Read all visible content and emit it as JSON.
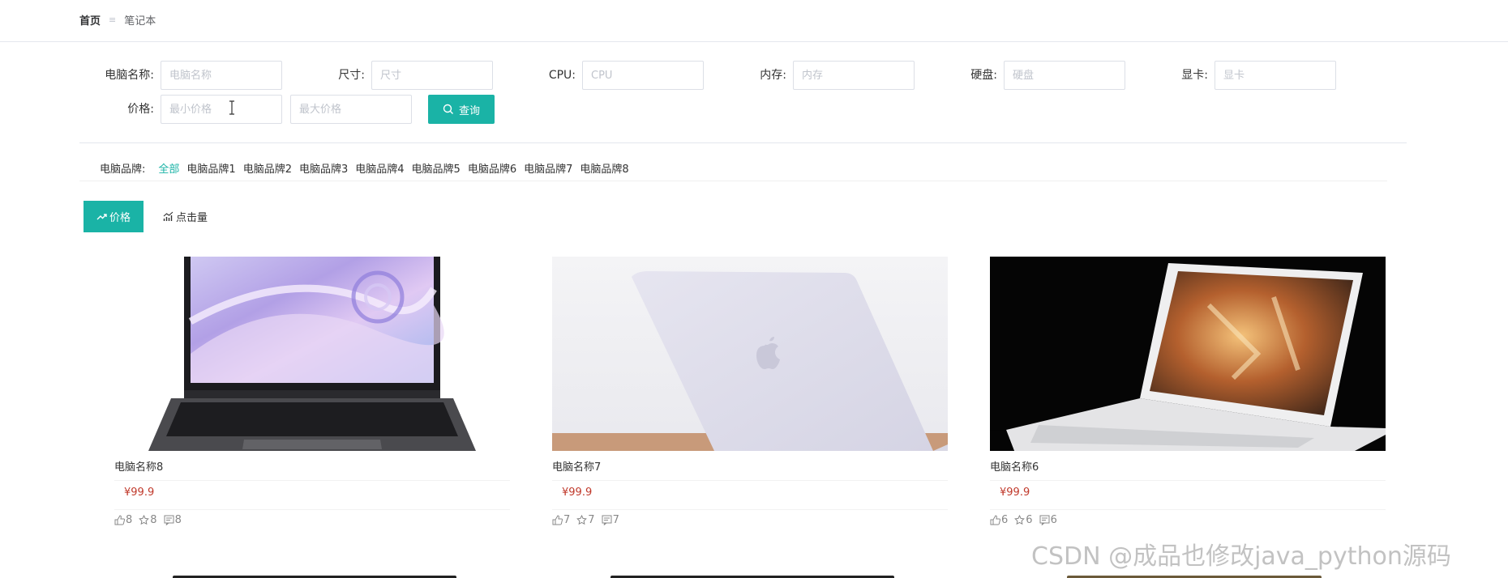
{
  "breadcrumb": {
    "home": "首页",
    "separator": "≡",
    "current": "笔记本"
  },
  "filters": {
    "name": {
      "label": "电脑名称:",
      "placeholder": "电脑名称"
    },
    "size": {
      "label": "尺寸:",
      "placeholder": "尺寸"
    },
    "cpu": {
      "label": "CPU:",
      "placeholder": "CPU"
    },
    "memory": {
      "label": "内存:",
      "placeholder": "内存"
    },
    "disk": {
      "label": "硬盘:",
      "placeholder": "硬盘"
    },
    "gpu": {
      "label": "显卡:",
      "placeholder": "显卡"
    },
    "price": {
      "label": "价格:",
      "min_placeholder": "最小价格",
      "max_placeholder": "最大价格"
    },
    "search_label": "查询"
  },
  "brands": {
    "label": "电脑品牌:",
    "items": [
      "全部",
      "电脑品牌1",
      "电脑品牌2",
      "电脑品牌3",
      "电脑品牌4",
      "电脑品牌5",
      "电脑品牌6",
      "电脑品牌7",
      "电脑品牌8"
    ],
    "active": "全部"
  },
  "sort": {
    "price_label": "价格",
    "clicks_label": "点击量"
  },
  "products": [
    {
      "name": "电脑名称8",
      "price": "¥99.9",
      "likes": "8",
      "favorites": "8",
      "comments": "8"
    },
    {
      "name": "电脑名称7",
      "price": "¥99.9",
      "likes": "7",
      "favorites": "7",
      "comments": "7"
    },
    {
      "name": "电脑名称6",
      "price": "¥99.9",
      "likes": "6",
      "favorites": "6",
      "comments": "6"
    }
  ],
  "watermark": "CSDN @成品也修改java_python源码",
  "colors": {
    "accent": "#1ab3a6",
    "price": "#c0392b"
  }
}
